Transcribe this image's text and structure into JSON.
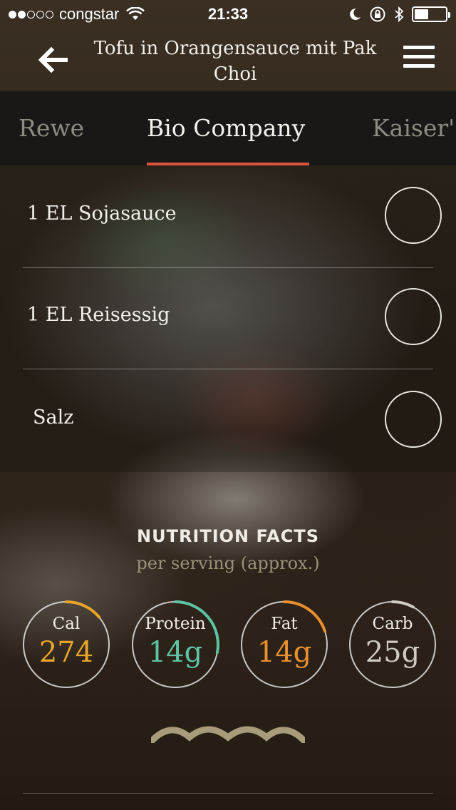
{
  "status_bar": {
    "signal_dots_filled": 2,
    "signal_dots_total": 5,
    "carrier": "congstar",
    "time": "21:33",
    "battery_level": 0.45
  },
  "nav": {
    "title": "Tofu in Orangensauce mit Pak Choi",
    "back_icon": "arrow-left-icon",
    "menu_icon": "hamburger-menu-icon"
  },
  "store_tabs": {
    "items": [
      "Rewe",
      "Bio Company",
      "Kaiser'"
    ],
    "active_index": 1,
    "accent": "#d9553f"
  },
  "ingredients": [
    {
      "label": "1 EL Sojasauce",
      "checked": false
    },
    {
      "label": "1 EL Reisessig",
      "checked": false
    },
    {
      "label": "Salz",
      "checked": false
    }
  ],
  "nutrition": {
    "title": "NUTRITION FACTS",
    "subtitle": "per serving (approx.)",
    "items": [
      {
        "label": "Cal",
        "value": "274",
        "color": "#e8a52a",
        "fraction": 0.14
      },
      {
        "label": "Protein",
        "value": "14g",
        "color": "#5cc4a4",
        "fraction": 0.28
      },
      {
        "label": "Fat",
        "value": "14g",
        "color": "#e8902e",
        "fraction": 0.2
      },
      {
        "label": "Carb",
        "value": "25g",
        "color": "#cfcac2",
        "fraction": 0.08
      }
    ],
    "wave_color": "#a69c79"
  }
}
